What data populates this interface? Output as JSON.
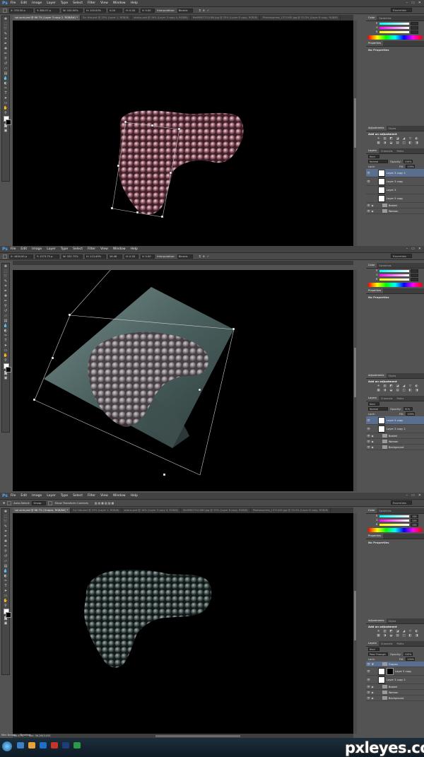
{
  "app": {
    "logo": "Ps",
    "menu": [
      "File",
      "Edit",
      "Image",
      "Layer",
      "Type",
      "Select",
      "Filter",
      "View",
      "Window",
      "Help"
    ],
    "workspace": "Essentials",
    "window_controls": [
      "–",
      "▭",
      "✕"
    ]
  },
  "panels": {
    "color_tabs": [
      "Color",
      "Swatches"
    ],
    "properties_tab": "Properties",
    "properties_text": "No Properties",
    "adjustments_tabs": [
      "Adjustments",
      "Styles"
    ],
    "adjustments_title": "Add an adjustment",
    "adjustment_icons": [
      "☀",
      "▥",
      "◩",
      "◪",
      "◢",
      "▽",
      "◐",
      "▦",
      "◑",
      "◒",
      "▤",
      "◫",
      "◧",
      "◨"
    ],
    "layers_tabs": [
      "Layers",
      "Channels",
      "Paths"
    ],
    "kind_label": "Kind",
    "lock_label": "Lock:",
    "opacity_label": "Opacity:",
    "fill_label": "Fill:"
  },
  "screens": [
    {
      "options": {
        "x": "X: 378.50 p",
        "y": "Y: 380.07 p",
        "w": "W: 100.00%",
        "h": "H: 100.00%",
        "angle": "0.00",
        "h_skew": "H: 0.00",
        "v_skew": "V: 0.00",
        "interpolation_label": "Interpolation:",
        "interpolation": "Bicubic"
      },
      "tabs": [
        "cpl-scrb.psd @ 66.7% (Layer 3 copy 2, RGB/8#) *",
        "Scr tito.psd @ 25% (Layer 1, RGB/8)",
        "status.psd @ 16% (Layer 3 copy 4, RGB/8)",
        "fileIMR07311080.jpg @ 25% (Layer 8 copy, RGB/8)",
        "Photoexpress_1371045.jpg @ 33.3% (Layer 8 copy, RGB/8)"
      ],
      "color": {
        "r": "",
        "g": "",
        "b": ""
      },
      "blend_mode": "Normal",
      "opacity": "100%",
      "fill": "100%",
      "layers": [
        {
          "name": "Layer 3 copy 2",
          "type": "layer",
          "active": true
        },
        {
          "name": "Layer 3 copy",
          "type": "layer",
          "active": false
        },
        {
          "name": "Layer 3",
          "type": "layer",
          "active": false
        },
        {
          "name": "Layer 5 copy",
          "type": "layer",
          "active": false
        },
        {
          "name": "Basket",
          "type": "group",
          "active": false
        },
        {
          "name": "Woman",
          "type": "group",
          "active": false
        }
      ]
    },
    {
      "options": {
        "x": "X: 1834.00 p",
        "y": "Y: 1573.75 p",
        "w": "W: 332.72%",
        "h": "H: 113.40%",
        "angle": "26.48",
        "h_skew": "H: 0.00",
        "v_skew": "V: 0.00",
        "interpolation_label": "Interpolation:",
        "interpolation": "Bicubic"
      },
      "tabs": [],
      "color": {
        "r": "",
        "g": "",
        "b": ""
      },
      "blend_mode": "Normal",
      "opacity": "51%",
      "fill": "100%",
      "layers": [
        {
          "name": "Layer 5 copy",
          "type": "layer",
          "active": true
        },
        {
          "name": "Layer 3 copy 2",
          "type": "layer",
          "active": false
        },
        {
          "name": "Basket",
          "type": "group",
          "active": false
        },
        {
          "name": "Woman",
          "type": "group",
          "active": false
        },
        {
          "name": "Background",
          "type": "group",
          "active": false
        }
      ]
    },
    {
      "options": {
        "auto_select": "Auto-Select:",
        "group": "Group",
        "transform": "Show Transform Controls"
      },
      "tabs": [
        "cpl-scrb.psd @ 66.7% (Grapes, RGB/8#) *",
        "Scr tito.psd @ 25% (Layer 1, RGB/8)",
        "status.psd @ 16% (Layer 3 copy 4, RGB/8)",
        "fileIMR07311080.jpg @ 25% (Layer 8 copy, RGB/8)",
        "Photoexpress_1371045.jpg @ 33.3% (Layer 8 copy, RGB/8)"
      ],
      "color": {
        "r": "255",
        "g": "255",
        "b": "255"
      },
      "blend_mode": "Pass Through",
      "opacity": "100%",
      "fill": "100%",
      "layers": [
        {
          "name": "Grapes",
          "type": "group",
          "active": true
        },
        {
          "name": "Layer 5 copy",
          "type": "masked",
          "active": false
        },
        {
          "name": "Layer 3 copy 2",
          "type": "layer",
          "active": false
        },
        {
          "name": "Basket",
          "type": "group",
          "active": false
        },
        {
          "name": "Woman",
          "type": "group",
          "active": false
        },
        {
          "name": "Background",
          "type": "group",
          "active": false
        }
      ],
      "status": {
        "zoom": "66.67%",
        "doc": "Doc: 56.2M/3.45G"
      },
      "bottom_tabs": [
        "Mini Bridge",
        "Timeline"
      ]
    }
  ],
  "watermark": "pxleyes.com"
}
